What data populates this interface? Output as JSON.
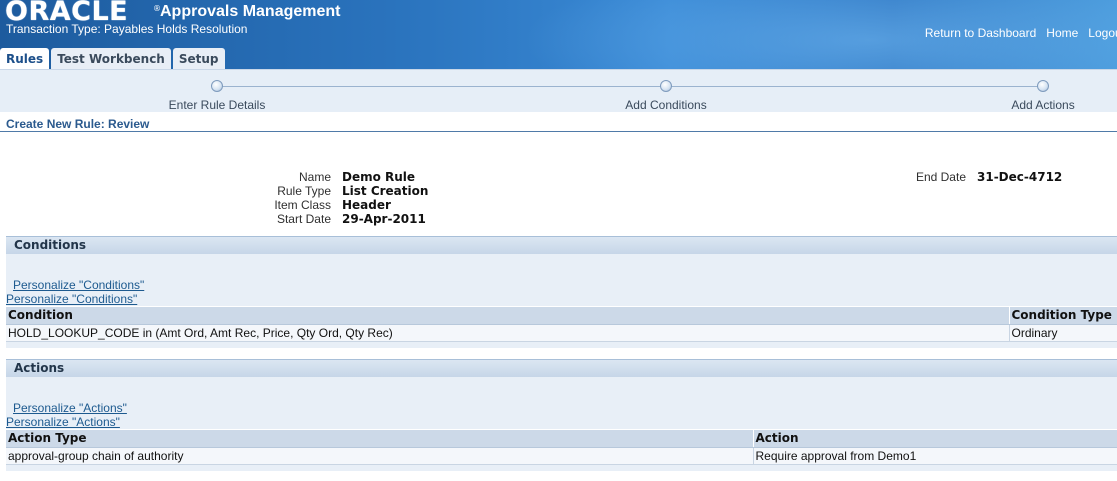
{
  "header": {
    "logo_text": "ORACLE",
    "logo_reg": "®",
    "app_title": "Approvals Management",
    "transaction_type": "Transaction Type: Payables Holds Resolution",
    "global_links": {
      "return_to_dashboard": "Return to Dashboard",
      "home": "Home",
      "logout": "Logout"
    }
  },
  "tabs": [
    {
      "label": "Rules",
      "active": true
    },
    {
      "label": "Test Workbench",
      "active": false
    },
    {
      "label": "Setup",
      "active": false
    }
  ],
  "train": {
    "steps": [
      "Enter Rule Details",
      "Add Conditions",
      "Add Actions"
    ]
  },
  "page": {
    "title": "Create New Rule: Review"
  },
  "summary": {
    "name_label": "Name",
    "name_value": "Demo Rule",
    "rule_type_label": "Rule Type",
    "rule_type_value": "List Creation",
    "item_class_label": "Item Class",
    "item_class_value": "Header",
    "start_date_label": "Start Date",
    "start_date_value": "29-Apr-2011",
    "end_date_label": "End Date",
    "end_date_value": "31-Dec-4712"
  },
  "conditions": {
    "header": "Conditions",
    "personalize_1": "Personalize \"Conditions\"",
    "personalize_2": "Personalize \"Conditions\"",
    "columns": [
      "Condition",
      "Condition Type"
    ],
    "rows": [
      [
        "HOLD_LOOKUP_CODE in (Amt Ord, Amt Rec, Price, Qty Ord, Qty Rec)",
        "Ordinary"
      ]
    ]
  },
  "actions": {
    "header": "Actions",
    "personalize_1": "Personalize \"Actions\"",
    "personalize_2": "Personalize \"Actions\"",
    "columns": [
      "Action Type",
      "Action"
    ],
    "rows": [
      [
        "approval-group chain of authority",
        "Require approval from Demo1"
      ]
    ]
  },
  "colors": {
    "banner": "#2a73bd",
    "link": "#1d5a8f",
    "section_bg": "#e8eff7"
  }
}
